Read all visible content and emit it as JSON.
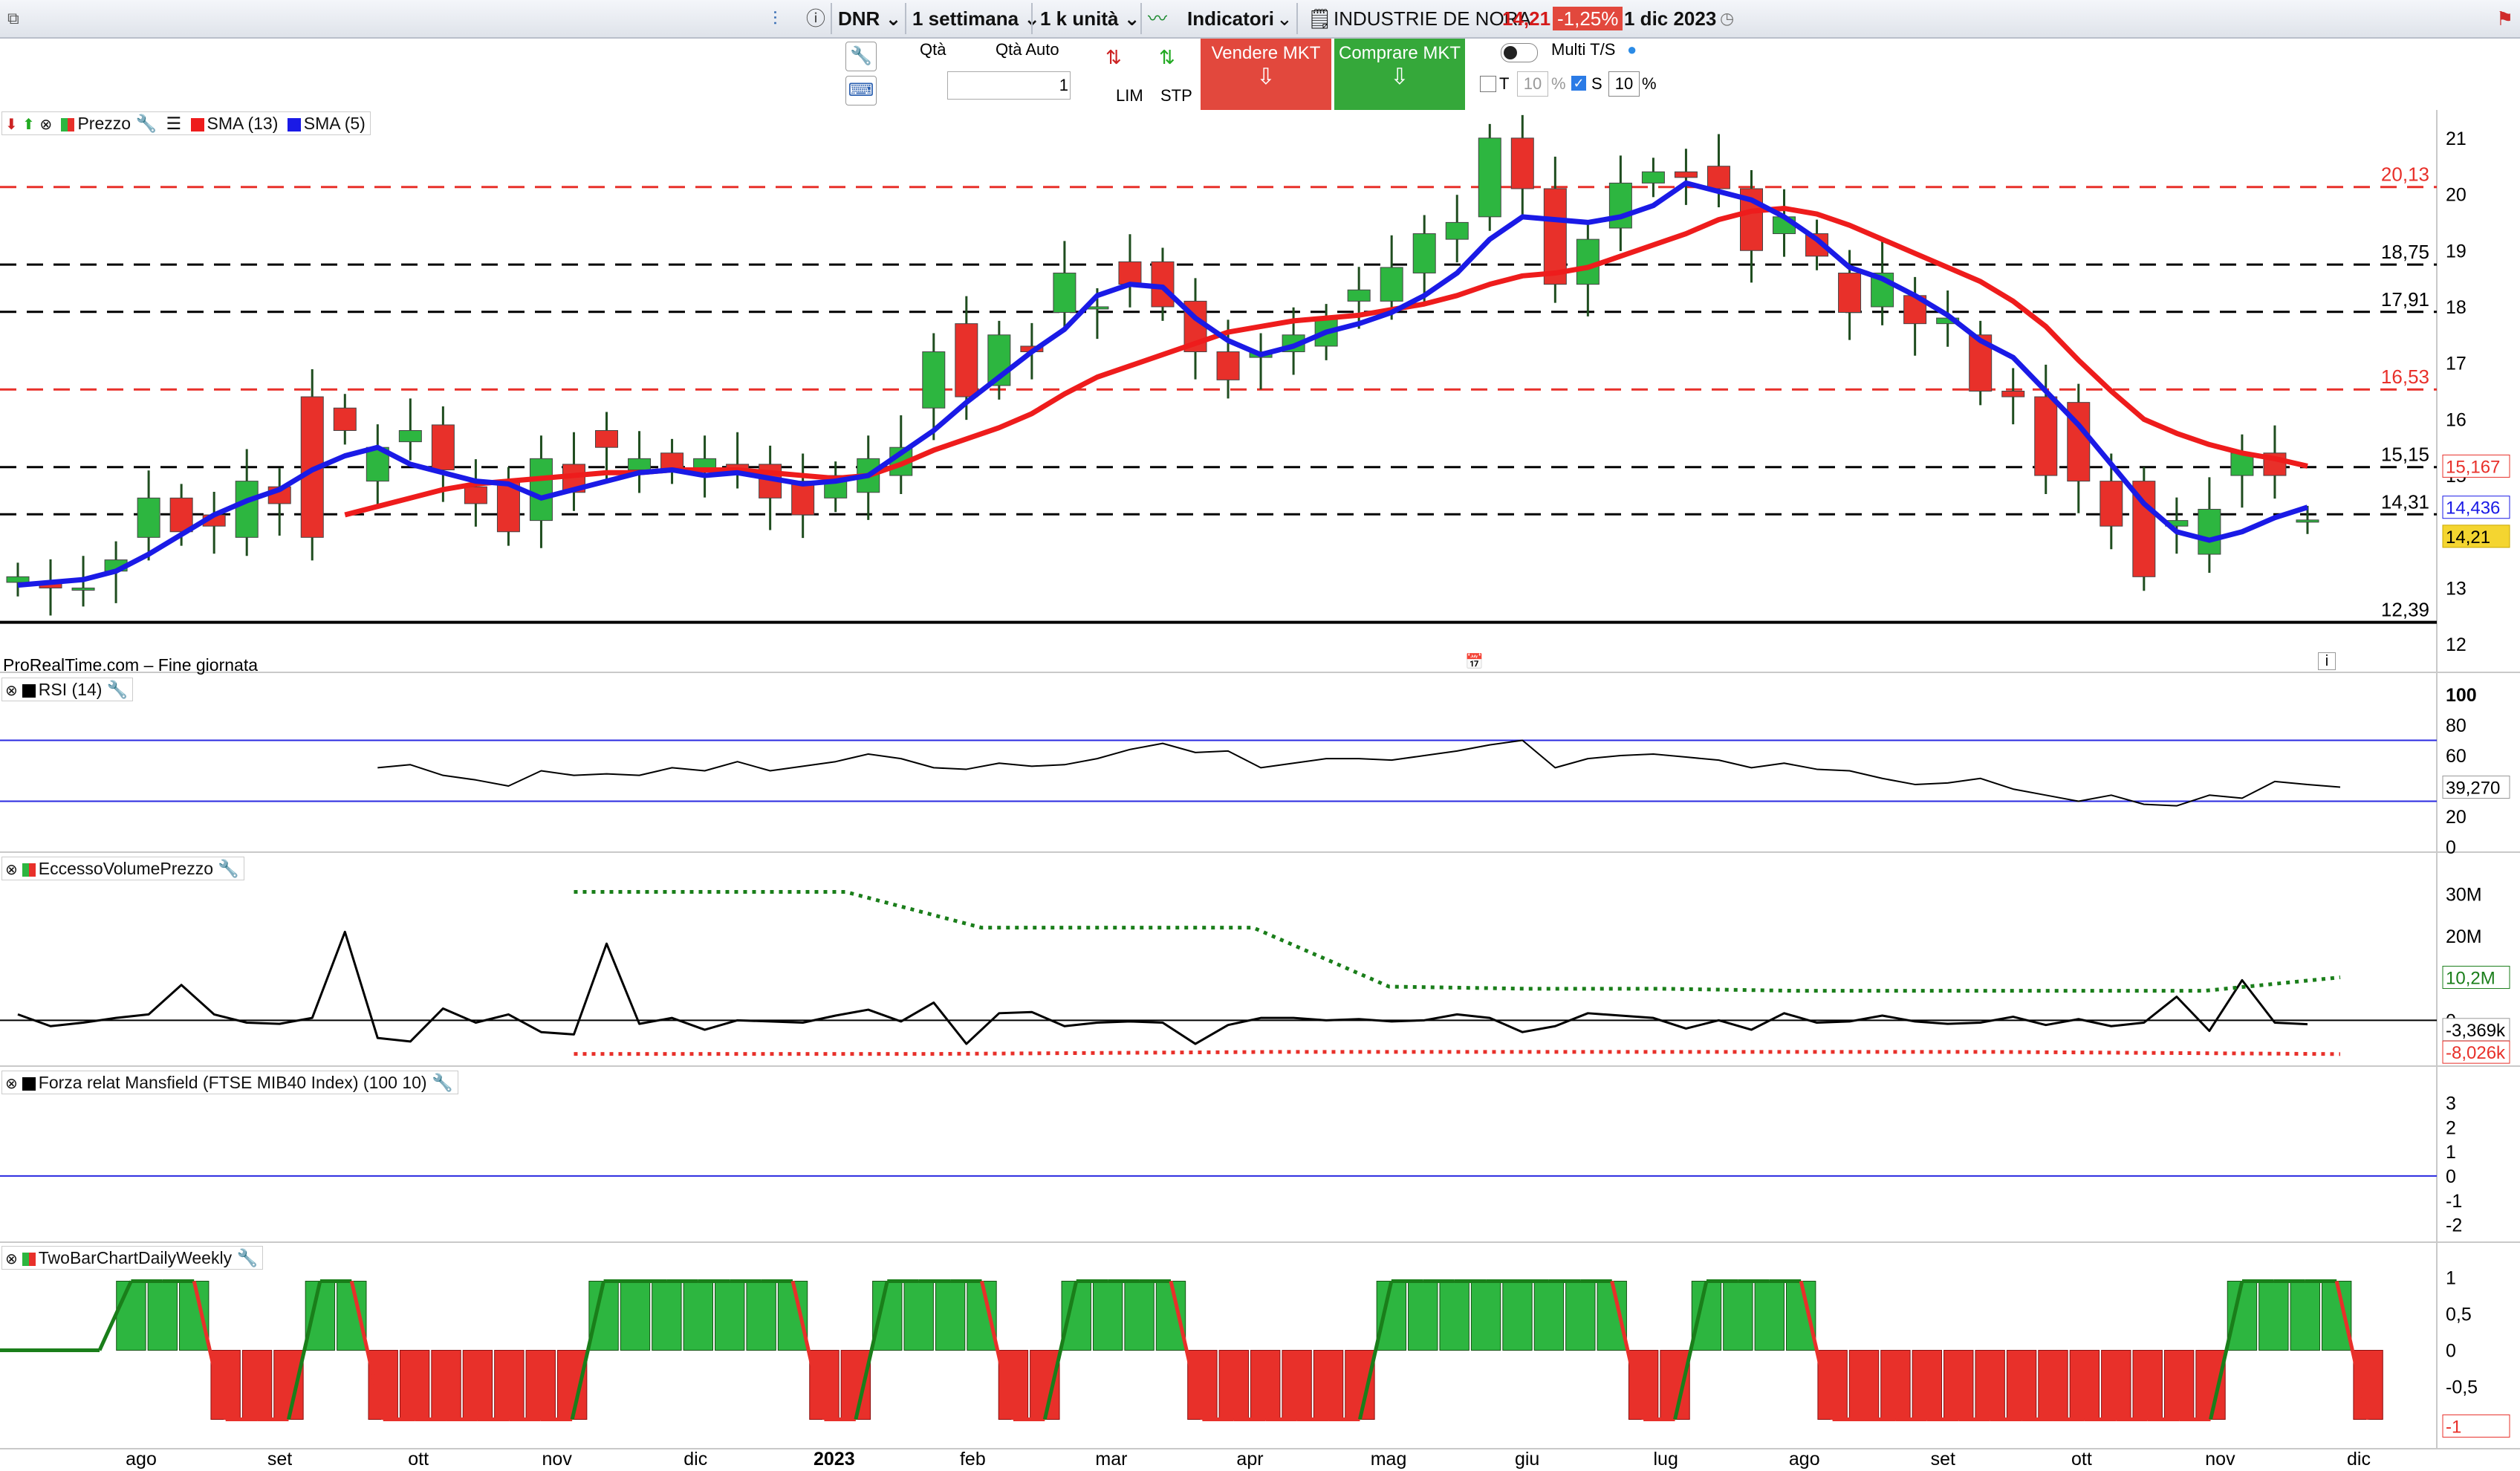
{
  "toolbar": {
    "ticker": "DNR",
    "period": "1 settimana",
    "units": "1 k unità",
    "indicators_label": "Indicatori",
    "instrument": "INDUSTRIE DE NORA",
    "last": "14,21",
    "change": "-1,25%",
    "date": "1 dic 2023"
  },
  "order": {
    "qty_label": "Qtà",
    "qty_auto_label": "Qtà Auto",
    "qty_value": "1",
    "lim": "LIM",
    "stp": "STP",
    "sell": "Vendere MKT",
    "buy": "Comprare MKT",
    "multi": "Multi T/S",
    "t_label": "T",
    "t_value": "10",
    "s_label": "S",
    "s_value": "10",
    "pct": "%"
  },
  "colors": {
    "up": "#2db640",
    "down": "#e8302a",
    "sma13": "#ee1c1c",
    "sma5": "#1a1ae6",
    "accent": "#e2483d"
  },
  "price_panel": {
    "title": "Prezzo",
    "sma13_label": "SMA (13)",
    "sma5_label": "SMA (5)",
    "source": "ProRealTime.com – Fine giornata",
    "axis": [
      "21",
      "20",
      "19",
      "18",
      "17",
      "16",
      "15",
      "14",
      "13",
      "12"
    ],
    "levels": [
      {
        "value": 20.13,
        "label": "20,13",
        "style": "red"
      },
      {
        "value": 18.75,
        "label": "18,75",
        "style": "black"
      },
      {
        "value": 17.91,
        "label": "17,91",
        "style": "black"
      },
      {
        "value": 16.53,
        "label": "16,53",
        "style": "red"
      },
      {
        "value": 15.15,
        "label": "15,15",
        "style": "black"
      },
      {
        "value": 14.31,
        "label": "14,31",
        "style": "black"
      },
      {
        "value": 12.39,
        "label": "12,39",
        "style": "solid"
      }
    ],
    "tag_sma13": "15,167",
    "tag_sma5": "14,436",
    "tag_last": "14,21"
  },
  "rsi_panel": {
    "title": "RSI (14)",
    "axis": [
      "100",
      "80",
      "60",
      "40",
      "20",
      "0"
    ],
    "tag": "39,270"
  },
  "evp_panel": {
    "title": "EccessoVolumePrezzo",
    "axis": [
      "30M",
      "20M",
      "10M",
      "0"
    ],
    "tag_upper": "10,2M",
    "tag_mid": "-3,369k",
    "tag_lower": "-8,026k"
  },
  "mansfield_panel": {
    "title": "Forza relat Mansfield (FTSE MIB40 Index) (100 10)",
    "axis": [
      "3",
      "2",
      "1",
      "0",
      "-1",
      "-2"
    ]
  },
  "twobar_panel": {
    "title": "TwoBarChartDailyWeekly",
    "axis": [
      "1",
      "0,5",
      "0",
      "-0,5"
    ],
    "tag": "-1"
  },
  "x_axis": [
    "ago",
    "set",
    "ott",
    "nov",
    "dic",
    "2023",
    "feb",
    "mar",
    "apr",
    "mag",
    "giu",
    "lug",
    "ago",
    "set",
    "ott",
    "nov",
    "dic"
  ],
  "chart_data": {
    "type": "candlestick",
    "x": [
      "2022-07-22",
      "2022-07-29",
      "2022-08-05",
      "2022-08-12",
      "2022-08-19",
      "2022-08-26",
      "2022-09-02",
      "2022-09-09",
      "2022-09-16",
      "2022-09-23",
      "2022-09-30",
      "2022-10-07",
      "2022-10-14",
      "2022-10-21",
      "2022-10-28",
      "2022-11-04",
      "2022-11-11",
      "2022-11-18",
      "2022-11-25",
      "2022-12-02",
      "2022-12-09",
      "2022-12-16",
      "2022-12-23",
      "2022-12-30",
      "2023-01-06",
      "2023-01-13",
      "2023-01-20",
      "2023-01-27",
      "2023-02-03",
      "2023-02-10",
      "2023-02-17",
      "2023-02-24",
      "2023-03-03",
      "2023-03-10",
      "2023-03-17",
      "2023-03-24",
      "2023-03-31",
      "2023-04-07",
      "2023-04-14",
      "2023-04-21",
      "2023-04-28",
      "2023-05-05",
      "2023-05-12",
      "2023-05-19",
      "2023-05-26",
      "2023-06-02",
      "2023-06-09",
      "2023-06-16",
      "2023-06-23",
      "2023-06-30",
      "2023-07-07",
      "2023-07-14",
      "2023-07-21",
      "2023-07-28",
      "2023-08-04",
      "2023-08-11",
      "2023-08-18",
      "2023-08-25",
      "2023-09-01",
      "2023-09-08",
      "2023-09-15",
      "2023-09-22",
      "2023-09-29",
      "2023-10-06",
      "2023-10-13",
      "2023-10-20",
      "2023-10-27",
      "2023-11-03",
      "2023-11-10",
      "2023-11-17",
      "2023-11-24",
      "2023-12-01"
    ],
    "open": [
      13.1,
      13.1,
      13.0,
      13.3,
      13.9,
      14.6,
      14.3,
      13.9,
      14.8,
      16.4,
      16.2,
      14.9,
      15.6,
      15.9,
      14.8,
      14.9,
      14.2,
      15.2,
      15.8,
      15.1,
      15.4,
      15.1,
      15.2,
      15.2,
      14.9,
      14.6,
      14.7,
      15.0,
      16.2,
      17.7,
      16.6,
      17.3,
      17.9,
      18.0,
      18.8,
      18.8,
      18.1,
      17.2,
      17.1,
      17.2,
      17.3,
      18.1,
      18.1,
      18.6,
      19.2,
      19.6,
      21.0,
      20.1,
      18.4,
      19.4,
      20.2,
      20.4,
      20.5,
      20.1,
      19.3,
      19.3,
      18.6,
      18.0,
      18.2,
      17.7,
      17.5,
      16.5,
      16.4,
      16.3,
      14.9,
      14.9,
      14.1,
      13.6,
      15.0,
      15.4,
      14.21
    ],
    "close": [
      13.2,
      13.0,
      13.0,
      13.5,
      14.6,
      14.0,
      14.1,
      14.9,
      14.5,
      13.9,
      15.8,
      15.5,
      15.8,
      15.1,
      14.5,
      14.0,
      15.3,
      14.7,
      15.5,
      15.3,
      15.1,
      15.3,
      15.1,
      14.6,
      14.3,
      15.0,
      15.3,
      15.5,
      17.2,
      16.4,
      17.5,
      17.2,
      18.6,
      18.0,
      18.4,
      18.0,
      17.2,
      16.7,
      17.2,
      17.5,
      17.8,
      18.3,
      18.7,
      19.3,
      19.5,
      21.0,
      20.1,
      18.4,
      19.2,
      20.2,
      20.4,
      20.3,
      20.1,
      19.0,
      19.6,
      18.9,
      17.9,
      18.6,
      17.7,
      17.8,
      16.5,
      16.4,
      15.0,
      14.9,
      14.1,
      13.2,
      14.2,
      14.4,
      15.4,
      15.0,
      14.21
    ],
    "sma5": [
      13.05,
      13.1,
      13.15,
      13.3,
      13.6,
      13.95,
      14.3,
      14.55,
      14.75,
      15.1,
      15.35,
      15.5,
      15.2,
      15.05,
      14.9,
      14.85,
      14.6,
      14.75,
      14.9,
      15.05,
      15.1,
      15.0,
      15.05,
      14.95,
      14.85,
      14.9,
      15.0,
      15.4,
      15.8,
      16.3,
      16.75,
      17.2,
      17.6,
      18.2,
      18.4,
      18.35,
      17.8,
      17.4,
      17.15,
      17.3,
      17.55,
      17.7,
      17.9,
      18.2,
      18.6,
      19.2,
      19.6,
      19.55,
      19.5,
      19.6,
      19.8,
      20.2,
      20.05,
      19.9,
      19.6,
      19.2,
      18.7,
      18.5,
      18.2,
      17.85,
      17.4,
      17.1,
      16.5,
      15.9,
      15.2,
      14.5,
      14.0,
      13.85,
      14.0,
      14.25,
      14.436
    ],
    "sma13": [
      null,
      null,
      null,
      null,
      null,
      null,
      null,
      null,
      null,
      null,
      14.3,
      14.45,
      14.6,
      14.75,
      14.85,
      14.9,
      14.95,
      15.0,
      15.05,
      15.05,
      15.1,
      15.1,
      15.1,
      15.05,
      15.0,
      14.95,
      15.0,
      15.2,
      15.45,
      15.65,
      15.85,
      16.1,
      16.45,
      16.75,
      16.95,
      17.15,
      17.35,
      17.55,
      17.65,
      17.75,
      17.8,
      17.85,
      17.95,
      18.05,
      18.2,
      18.4,
      18.55,
      18.6,
      18.7,
      18.9,
      19.1,
      19.3,
      19.55,
      19.7,
      19.75,
      19.65,
      19.45,
      19.2,
      18.95,
      18.7,
      18.45,
      18.1,
      17.65,
      17.05,
      16.5,
      16.0,
      15.75,
      15.55,
      15.4,
      15.3,
      15.167
    ],
    "rsi": [
      52,
      54,
      47,
      44,
      40,
      50,
      47,
      48,
      47,
      52,
      50,
      56,
      50,
      53,
      56,
      61,
      58,
      52,
      51,
      55,
      53,
      54,
      58,
      64,
      68,
      62,
      63,
      52,
      55,
      58,
      58,
      57,
      60,
      63,
      67,
      70,
      52,
      58,
      60,
      61,
      59,
      57,
      52,
      55,
      51,
      50,
      45,
      41,
      42,
      45,
      38,
      34,
      30,
      34,
      28,
      27,
      34,
      32,
      43,
      41,
      39.27
    ],
    "evp_osc": [
      0.5,
      -0.5,
      -0.2,
      0.2,
      0.5,
      3.0,
      0.5,
      -0.2,
      -0.3,
      0.2,
      7.5,
      -1.5,
      -1.8,
      1.0,
      -0.2,
      0.5,
      -1.0,
      -1.2,
      6.5,
      -0.3,
      0.2,
      -0.8,
      0.0,
      -0.1,
      -0.2,
      0.4,
      0.9,
      -0.1,
      1.5,
      -2.0,
      0.6,
      0.7,
      -0.5,
      -0.2,
      -0.1,
      -0.2,
      -2.0,
      -0.4,
      0.2,
      0.2,
      0.0,
      0.1,
      -0.1,
      0.0,
      0.5,
      0.2,
      -1.0,
      -0.5,
      0.6,
      0.4,
      0.2,
      -0.7,
      0.0,
      -0.8,
      0.6,
      -0.2,
      -0.1,
      0.4,
      -0.1,
      -0.3,
      -0.2,
      0.3,
      -0.4,
      0.1,
      -0.5,
      -0.2,
      2.0,
      -0.9,
      3.4,
      -0.2,
      -0.337
    ],
    "evp_upper_band": [
      30.5,
      30.5,
      30.5,
      22.0,
      22.0,
      22.0,
      8.0,
      7.5,
      7.5,
      7.0,
      7.0,
      7.0,
      7.0,
      10.2
    ],
    "evp_lower_band": [
      -8.0,
      -8.0,
      -7.5,
      -7.5,
      -7.5,
      -8.026
    ],
    "twobar": [
      0,
      1,
      1,
      1,
      -1,
      -1,
      -1,
      1,
      1,
      -1,
      -1,
      -1,
      -1,
      -1,
      -1,
      -1,
      1,
      1,
      1,
      1,
      1,
      1,
      1,
      -1,
      -1,
      1,
      1,
      1,
      1,
      -1,
      -1,
      1,
      1,
      1,
      1,
      -1,
      -1,
      -1,
      -1,
      -1,
      -1,
      1,
      1,
      1,
      1,
      1,
      1,
      1,
      1,
      -1,
      -1,
      1,
      1,
      1,
      1,
      -1,
      -1,
      -1,
      -1,
      -1,
      -1,
      -1,
      -1,
      -1,
      -1,
      -1,
      -1,
      -1,
      1,
      1,
      1,
      1,
      -1
    ]
  }
}
